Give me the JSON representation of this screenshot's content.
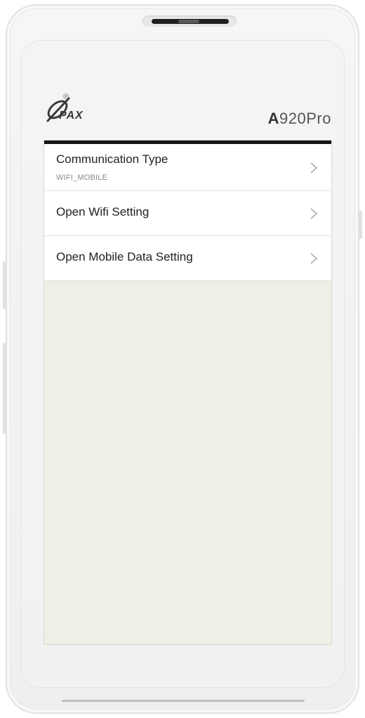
{
  "device": {
    "brand": "PAX",
    "model_prefix": "A",
    "model_suffix": "920Pro",
    "registered_mark": "®"
  },
  "settings_list": {
    "items": [
      {
        "title": "Communication Type",
        "subtitle": "WIFI_MOBILE",
        "icon": "chevron-right-icon"
      },
      {
        "title": "Open Wifi Setting",
        "icon": "chevron-right-icon"
      },
      {
        "title": "Open Mobile Data Setting",
        "icon": "chevron-right-icon"
      }
    ]
  },
  "colors": {
    "screen_background": "#f0efe6",
    "list_background": "#ffffff",
    "status_bar": "#141414",
    "text_primary": "#222222",
    "text_secondary": "#8a8a8a"
  }
}
